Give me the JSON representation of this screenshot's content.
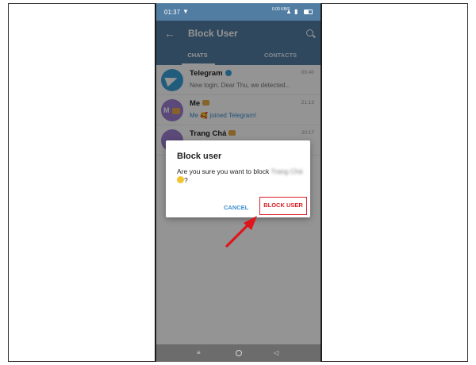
{
  "status_bar": {
    "time": "01:37",
    "speed": "0.00 KB/S",
    "wifi_icon": "wifi-icon",
    "signal_icon": "signal-icon",
    "battery_icon": "battery-icon",
    "background": "#517da2"
  },
  "toolbar": {
    "title": "Block User",
    "back_icon": "arrow-left-icon",
    "search_icon": "search-icon"
  },
  "tabs": [
    {
      "label": "CHATS",
      "active": true
    },
    {
      "label": "CONTACTS",
      "active": false
    }
  ],
  "chats": [
    {
      "name": "Telegram",
      "verified": true,
      "time": "00:40",
      "preview": "New login. Dear Thu, we detected...",
      "avatar_icon": "paper-plane-icon"
    },
    {
      "name": "Me",
      "initials": "M",
      "time": "21:13",
      "preview": "Me 🥰 joined Telegram!",
      "preview_accent": true
    },
    {
      "name": "Trang Chá",
      "time": "20:17",
      "preview": ""
    }
  ],
  "dialog": {
    "title": "Block user",
    "message_prefix": "Are you sure you want to block",
    "blurred_name": "Trang Chá",
    "message_suffix": "?",
    "cancel_label": "CANCEL",
    "confirm_label": "BLOCK USER"
  },
  "nav_bar": {
    "menu_glyph": "≡",
    "back_glyph": "◁"
  },
  "colors": {
    "brand": "#517da2",
    "accent": "#3a8fd0",
    "highlight": "#d81e24"
  }
}
